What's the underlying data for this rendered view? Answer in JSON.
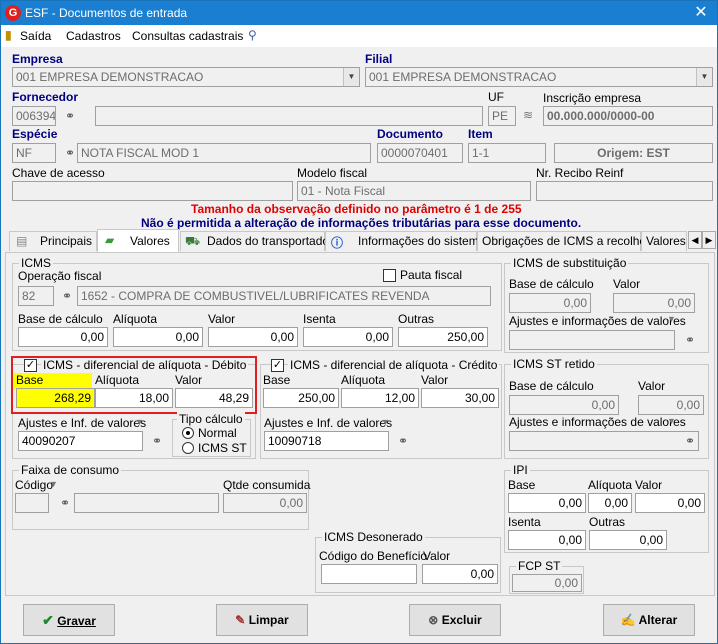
{
  "window": {
    "title": "ESF - Documentos de entrada",
    "close": "✕"
  },
  "menu": {
    "items": [
      "Saída",
      "Cadastros",
      "Consultas cadastrais"
    ]
  },
  "empresa": {
    "label": "Empresa",
    "value": "001 EMPRESA DEMONSTRACAO"
  },
  "filial": {
    "label": "Filial",
    "value": "001 EMPRESA DEMONSTRACAO"
  },
  "fornecedor": {
    "label": "Fornecedor",
    "code": "006394"
  },
  "uf": {
    "label": "UF",
    "value": "PE"
  },
  "inscricao": {
    "label": "Inscrição empresa",
    "value": "00.000.000/0000-00"
  },
  "especie": {
    "label": "Espécie",
    "code": "NF",
    "desc": "NOTA FISCAL MOD 1"
  },
  "documento": {
    "label": "Documento",
    "value": "0000070401"
  },
  "item": {
    "label": "Item",
    "value": "1-1"
  },
  "origem": {
    "text": "Origem: EST"
  },
  "chave": {
    "label": "Chave de acesso"
  },
  "modelo": {
    "label": "Modelo fiscal",
    "value": "01 - Nota Fiscal"
  },
  "recibo": {
    "label": "Nr. Recibo Reinf"
  },
  "messages": {
    "line1": "Tamanho da observação definido no parâmetro é 1 de 255",
    "line2": "Não é permitida a alteração de informações tributárias para esse documento."
  },
  "tabs": [
    "Principais",
    "Valores",
    "Dados do transportador",
    "Informações do sistema",
    "Obrigações de ICMS a recolher",
    "Valores"
  ],
  "icms": {
    "title": "ICMS",
    "op_label": "Operação fiscal",
    "op_code": "82",
    "op_desc": "1652 - COMPRA DE COMBUSTIVEL/LUBRIFICATES REVENDA",
    "pauta": "Pauta fiscal",
    "base_label": "Base de cálculo",
    "aliq_label": "Alíquota",
    "valor_label": "Valor",
    "isenta_label": "Isenta",
    "outras_label": "Outras",
    "base": "0,00",
    "aliq": "0,00",
    "valor": "0,00",
    "isenta": "0,00",
    "outras": "250,00"
  },
  "difal_deb": {
    "title": "ICMS - diferencial de alíquota - Débito",
    "check": "✓",
    "base_label": "Base",
    "aliq_label": "Alíquota",
    "valor_label": "Valor",
    "base": "268,29",
    "aliq": "18,00",
    "valor": "48,29",
    "ajustes_label": "Ajustes e Inf. de valores",
    "ajustes": "40090207"
  },
  "tipo_calculo": {
    "title": "Tipo cálculo",
    "normal": "Normal",
    "icms_st": "ICMS ST"
  },
  "difal_cred": {
    "title": "ICMS - diferencial de alíquota - Crédito",
    "check": "✓",
    "base_label": "Base",
    "aliq_label": "Alíquota",
    "valor_label": "Valor",
    "base": "250,00",
    "aliq": "12,00",
    "valor": "30,00",
    "ajustes_label": "Ajustes e Inf. de valores",
    "ajustes": "10090718"
  },
  "icms_sub": {
    "title": "ICMS de substituição",
    "base_label": "Base de cálculo",
    "valor_label": "Valor",
    "base": "0,00",
    "valor": "0,00",
    "ajustes_label": "Ajustes e informações de valores"
  },
  "icms_st_retido": {
    "title": "ICMS ST retido",
    "base_label": "Base de cálculo",
    "valor_label": "Valor",
    "base": "0,00",
    "valor": "0,00",
    "ajustes_label": "Ajustes e informações de valores"
  },
  "faixa": {
    "title": "Faixa de consumo",
    "codigo_label": "Código",
    "qtde_label": "Qtde consumida",
    "qtde": "0,00"
  },
  "ipi": {
    "title": "IPI",
    "base_label": "Base",
    "aliq_label": "Alíquota",
    "valor_label": "Valor",
    "base": "0,00",
    "aliq": "0,00",
    "valor": "0,00",
    "isenta_label": "Isenta",
    "outras_label": "Outras",
    "isenta": "0,00",
    "outras": "0,00"
  },
  "icms_desonerado": {
    "title": "ICMS Desonerado",
    "codigo_label": "Código do Benefício",
    "valor_label": "Valor",
    "valor": "0,00"
  },
  "fcp_st": {
    "title": "FCP ST",
    "valor": "0,00"
  },
  "buttons": {
    "gravar": "Gravar",
    "limpar": "Limpar",
    "excluir": "Excluir",
    "alterar": "Alterar"
  },
  "colors": {
    "titlebar": "#1a7fd0",
    "highlight_border": "#e02020",
    "highlight_fill": "#ffff00",
    "message_red": "#e00000",
    "message_blue": "#000080"
  }
}
